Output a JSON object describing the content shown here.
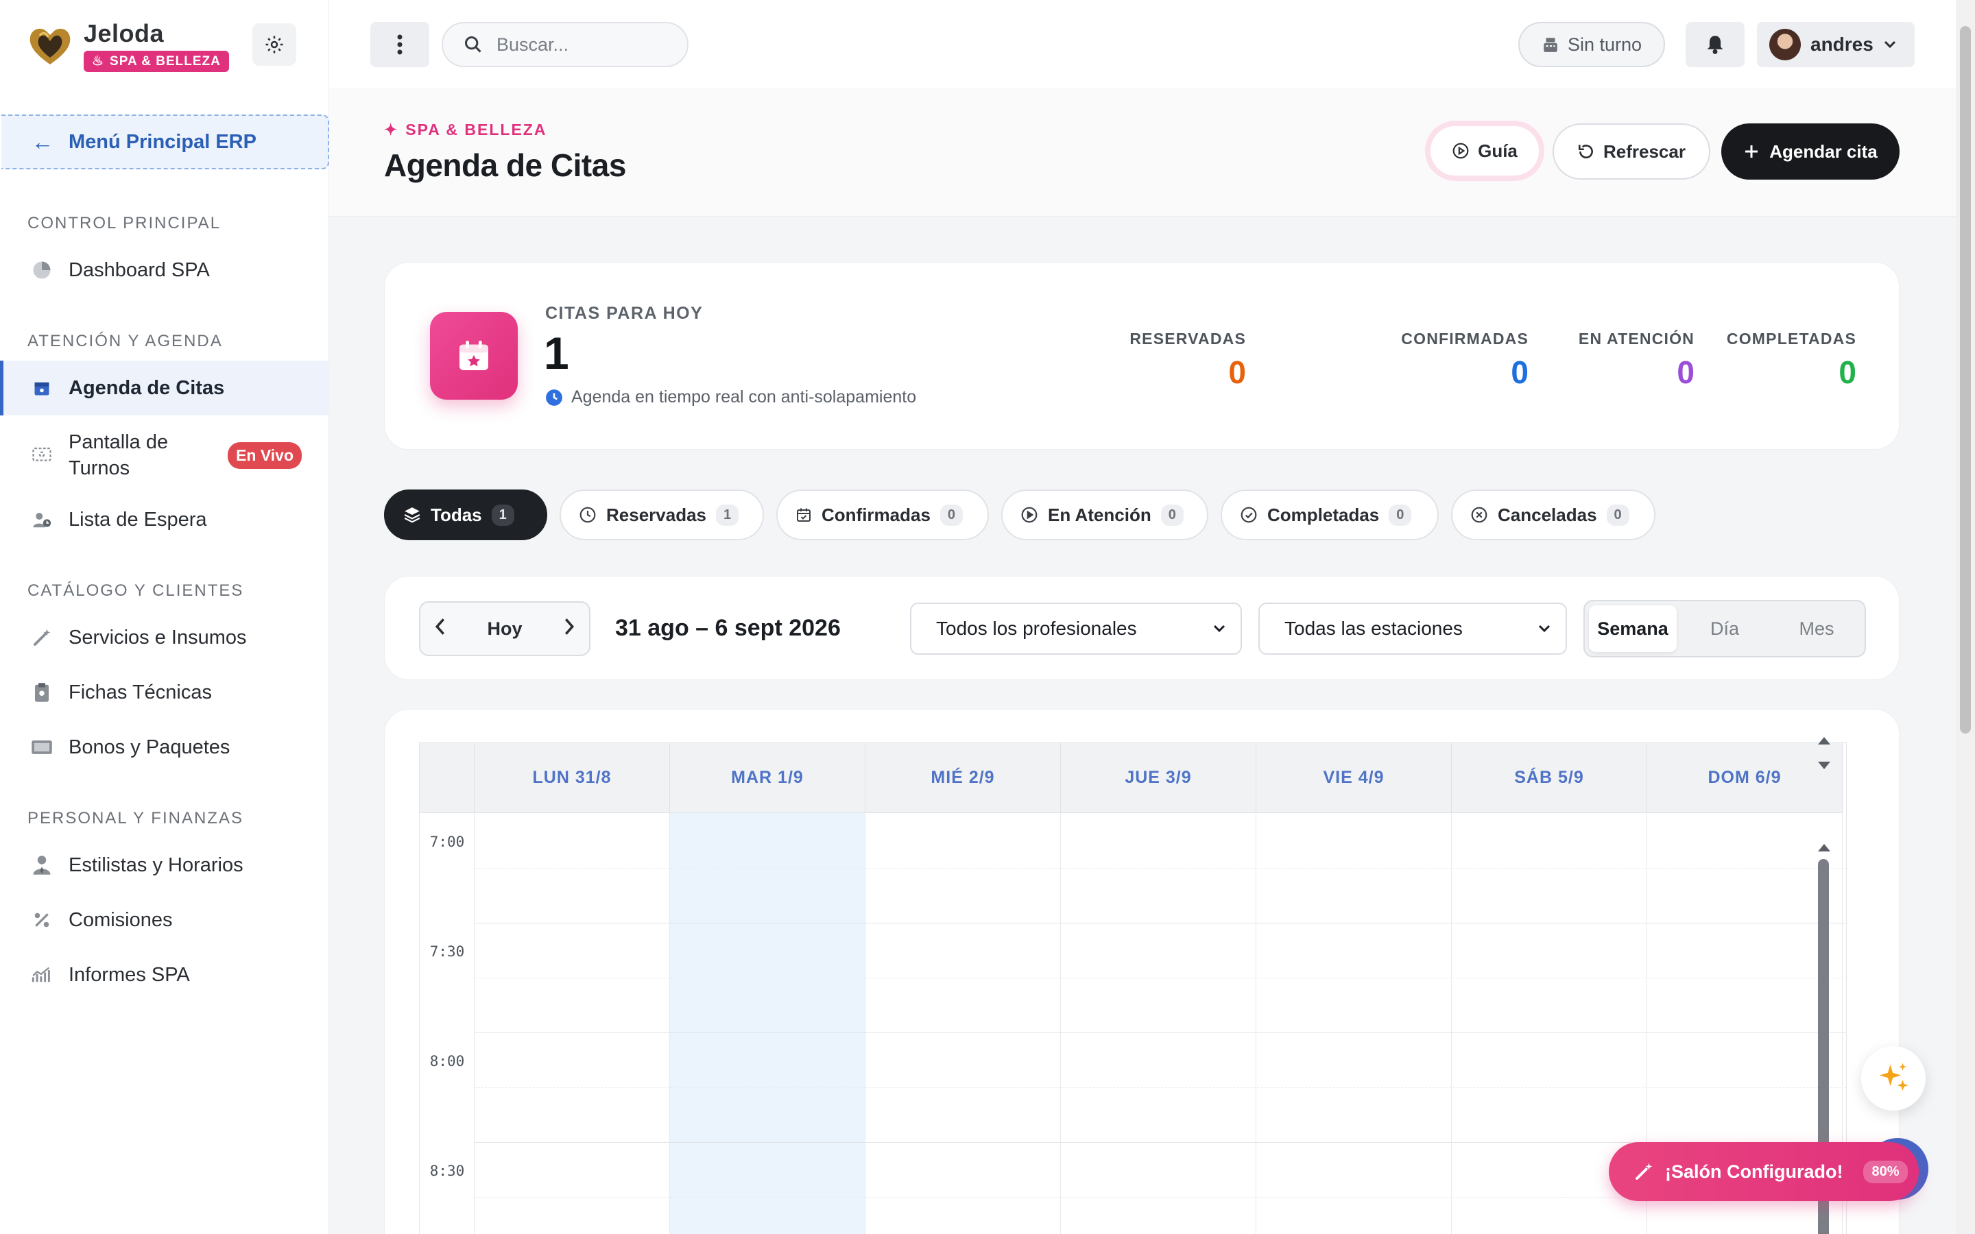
{
  "brand": {
    "name": "Jeloda",
    "badge": "SPA & BELLEZA"
  },
  "sidebar": {
    "back_label": "Menú Principal ERP",
    "sections": [
      {
        "title": "CONTROL PRINCIPAL",
        "items": [
          {
            "label": "Dashboard SPA",
            "icon": "pie-chart-icon"
          }
        ]
      },
      {
        "title": "ATENCIÓN Y AGENDA",
        "items": [
          {
            "label": "Agenda de Citas",
            "icon": "calendar-icon",
            "active": true
          },
          {
            "label": "Pantalla de Turnos",
            "icon": "screen-icon",
            "badge": "En Vivo"
          },
          {
            "label": "Lista de Espera",
            "icon": "user-clock-icon"
          }
        ]
      },
      {
        "title": "CATÁLOGO Y CLIENTES",
        "items": [
          {
            "label": "Servicios e Insumos",
            "icon": "magic-wand-icon"
          },
          {
            "label": "Fichas Técnicas",
            "icon": "clipboard-icon"
          },
          {
            "label": "Bonos y Paquetes",
            "icon": "ticket-icon"
          }
        ]
      },
      {
        "title": "PERSONAL Y FINANZAS",
        "items": [
          {
            "label": "Estilistas y Horarios",
            "icon": "user-tie-icon"
          },
          {
            "label": "Comisiones",
            "icon": "percent-icon"
          },
          {
            "label": "Informes SPA",
            "icon": "chart-line-icon"
          }
        ]
      }
    ]
  },
  "topbar": {
    "search_placeholder": "Buscar...",
    "shift_label": "Sin turno",
    "user_name": "andres"
  },
  "header": {
    "eyebrow": "SPA & BELLEZA",
    "title": "Agenda de Citas",
    "guide_label": "Guía",
    "refresh_label": "Refrescar",
    "new_label": "Agendar cita"
  },
  "stats": {
    "today_label": "CITAS PARA HOY",
    "today_count": "1",
    "subtitle": "Agenda en tiempo real con anti-solapamiento",
    "items": [
      {
        "label": "RESERVADAS",
        "value": "0",
        "color": "#e8620c"
      },
      {
        "label": "CONFIRMADAS",
        "value": "0",
        "color": "#1f6fe0"
      },
      {
        "label": "EN ATENCIÓN",
        "value": "0",
        "color": "#9b4fd8"
      },
      {
        "label": "COMPLETADAS",
        "value": "0",
        "color": "#22b24c"
      }
    ]
  },
  "filters": [
    {
      "label": "Todas",
      "count": "1",
      "icon": "layers-icon",
      "active": true
    },
    {
      "label": "Reservadas",
      "count": "1",
      "icon": "clock-icon"
    },
    {
      "label": "Confirmadas",
      "count": "0",
      "icon": "calendar-check-icon"
    },
    {
      "label": "En Atención",
      "count": "0",
      "icon": "play-circle-icon"
    },
    {
      "label": "Completadas",
      "count": "0",
      "icon": "check-circle-icon"
    },
    {
      "label": "Canceladas",
      "count": "0",
      "icon": "x-circle-icon"
    }
  ],
  "toolbar": {
    "today_label": "Hoy",
    "range": "31 ago – 6 sept 2026",
    "professional_select": "Todos los profesionales",
    "station_select": "Todas las estaciones",
    "views": [
      {
        "label": "Semana",
        "active": true
      },
      {
        "label": "Día"
      },
      {
        "label": "Mes"
      }
    ]
  },
  "calendar": {
    "days": [
      "LUN 31/8",
      "MAR 1/9",
      "MIÉ 2/9",
      "JUE 3/9",
      "VIE 4/9",
      "SÁB 5/9",
      "DOM 6/9"
    ],
    "today_index": 1,
    "times": [
      "7:00",
      "7:30",
      "8:00",
      "8:30"
    ]
  },
  "floating": {
    "salon_label": "¡Salón Configurado!",
    "salon_pct": "80%"
  },
  "colors": {
    "brand_pink": "#e0317c",
    "accent_blue": "#3767c6",
    "dark": "#17191c"
  }
}
